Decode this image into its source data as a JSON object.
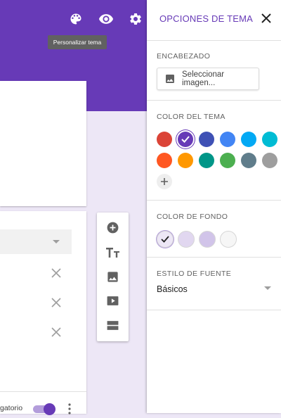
{
  "tooltip": "Personalizar tema",
  "bottom": {
    "required_label": "gatorio"
  },
  "panel": {
    "title": "OPCIONES DE TEMA",
    "header_section": "ENCABEZADO",
    "select_image": "Seleccionar imagen...",
    "theme_color_section": "COLOR DEL TEMA",
    "theme_colors": [
      "#db4437",
      "#673ab7",
      "#3f51b5",
      "#4285f4",
      "#03a9f4",
      "#00bcd4",
      "#ff5722",
      "#ff9800",
      "#009688",
      "#4caf50",
      "#607d8b",
      "#9e9e9e"
    ],
    "selected_theme_color": "#673ab7",
    "background_section": "COLOR DE FONDO",
    "background_colors": [
      "#ede7f6",
      "#e1d7f0",
      "#d1c4e9",
      "#f6f6f6"
    ],
    "font_section": "ESTILO DE FUENTE",
    "font_value": "Básicos"
  },
  "icons": {
    "top": [
      "palette-icon",
      "eye-icon",
      "gear-icon"
    ],
    "toolbar": [
      "add-circle-icon",
      "title-icon",
      "image-icon",
      "video-icon",
      "section-icon"
    ]
  }
}
